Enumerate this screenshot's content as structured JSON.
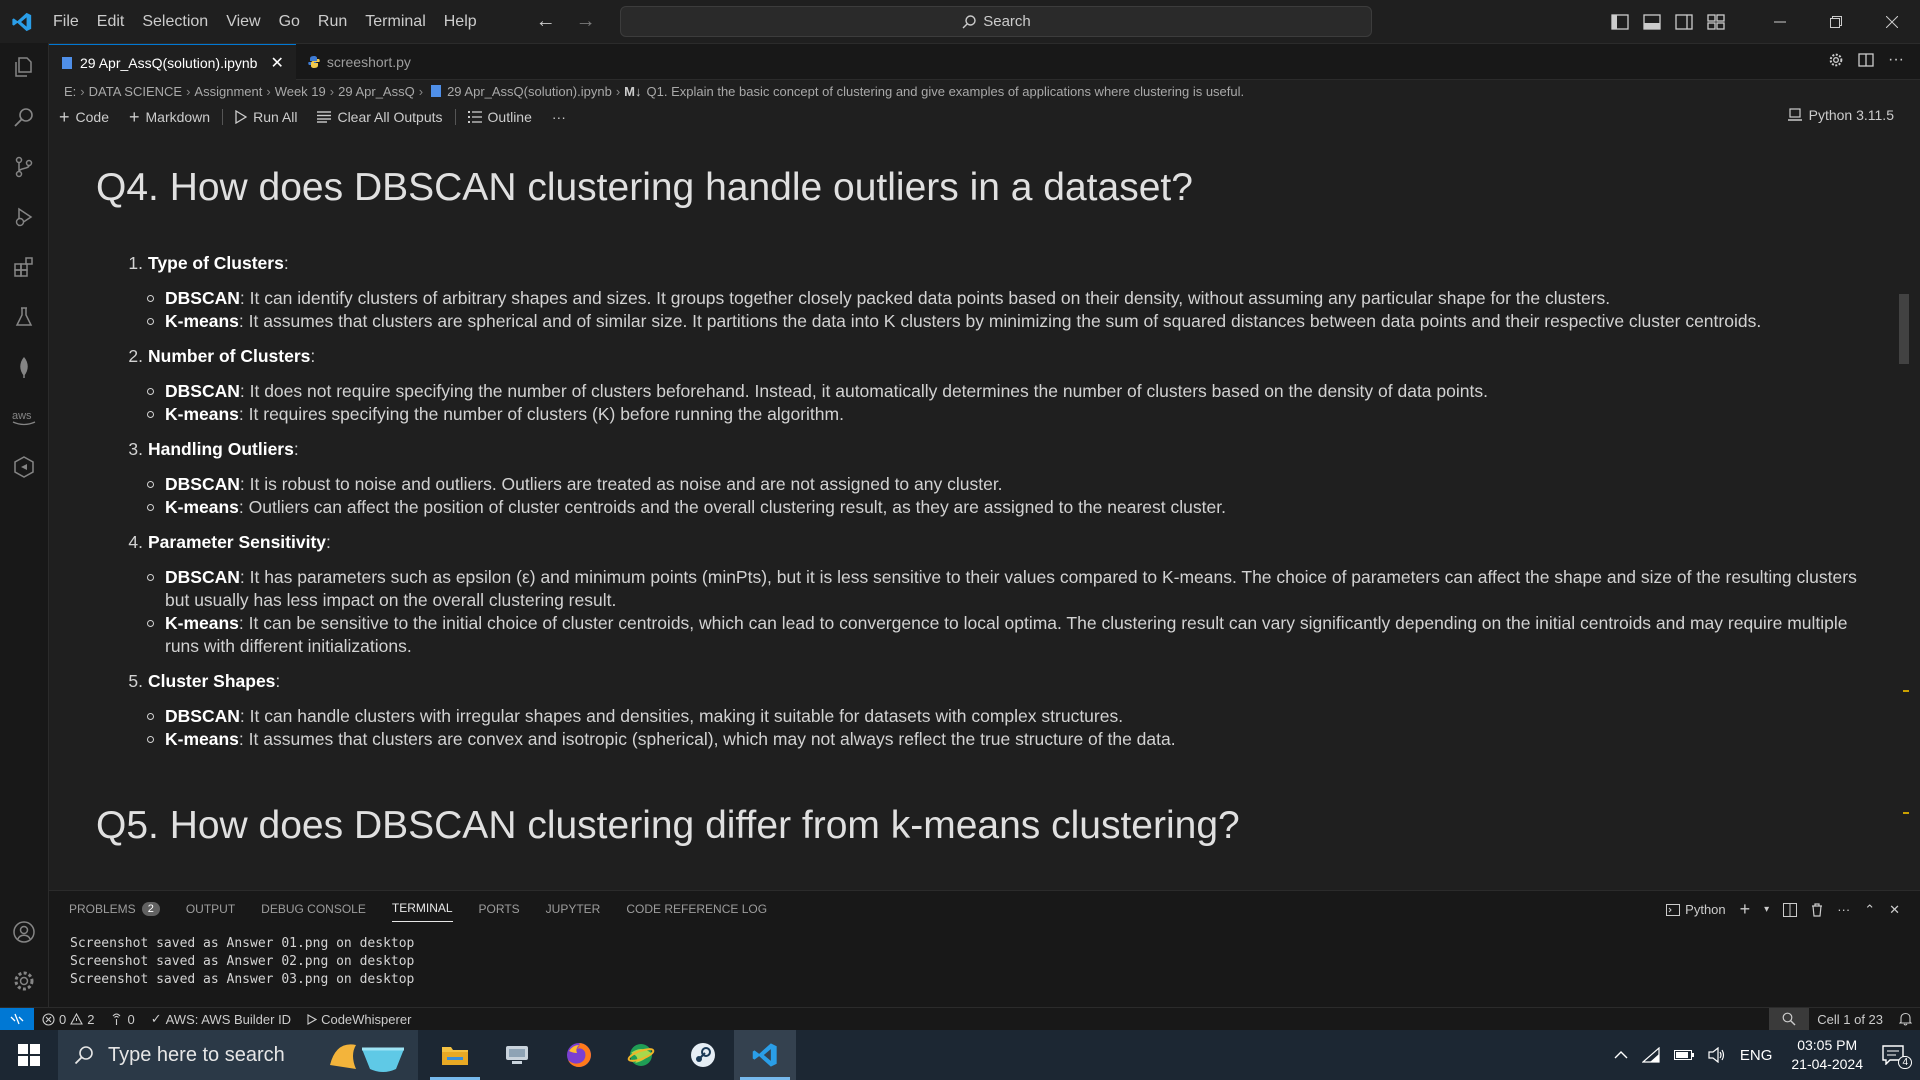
{
  "menu": [
    "File",
    "Edit",
    "Selection",
    "View",
    "Go",
    "Run",
    "Terminal",
    "Help"
  ],
  "search": {
    "label": "Search"
  },
  "tabs": [
    {
      "label": "29 Apr_AssQ(solution).ipynb",
      "active": true
    },
    {
      "label": "screeshort.py",
      "active": false
    }
  ],
  "breadcrumb": [
    "E:",
    "DATA SCIENCE",
    "Assignment",
    "Week 19",
    "29 Apr_AssQ",
    "29 Apr_AssQ(solution).ipynb",
    "Q1. Explain the basic concept of clustering and give examples of applications where clustering is useful."
  ],
  "breadcrumb_md_marker": "M↓",
  "toolbar": {
    "code": "Code",
    "markdown": "Markdown",
    "run_all": "Run All",
    "clear_outputs": "Clear All Outputs",
    "outline": "Outline",
    "more": "···",
    "kernel": "Python 3.11.5"
  },
  "notebook": {
    "q4_heading": "Q4. How does DBSCAN clustering handle outliers in a dataset?",
    "items": [
      {
        "num": "1.",
        "title": "Type of Clusters",
        "dbscan": "It can identify clusters of arbitrary shapes and sizes. It groups together closely packed data points based on their density, without assuming any particular shape for the clusters.",
        "kmeans": "It assumes that clusters are spherical and of similar size. It partitions the data into K clusters by minimizing the sum of squared distances between data points and their respective cluster centroids."
      },
      {
        "num": "2.",
        "title": "Number of Clusters",
        "dbscan": "It does not require specifying the number of clusters beforehand. Instead, it automatically determines the number of clusters based on the density of data points.",
        "kmeans": "It requires specifying the number of clusters (K) before running the algorithm."
      },
      {
        "num": "3.",
        "title": "Handling Outliers",
        "dbscan": "It is robust to noise and outliers. Outliers are treated as noise and are not assigned to any cluster.",
        "kmeans": "Outliers can affect the position of cluster centroids and the overall clustering result, as they are assigned to the nearest cluster."
      },
      {
        "num": "4.",
        "title": "Parameter Sensitivity",
        "dbscan": "It has parameters such as epsilon (ε) and minimum points (minPts), but it is less sensitive to their values compared to K-means. The choice of parameters can affect the shape and size of the resulting clusters but usually has less impact on the overall clustering result.",
        "kmeans": "It can be sensitive to the initial choice of cluster centroids, which can lead to convergence to local optima. The clustering result can vary significantly depending on the initial centroids and may require multiple runs with different initializations."
      },
      {
        "num": "5.",
        "title": "Cluster Shapes",
        "dbscan": "It can handle clusters with irregular shapes and densities, making it suitable for datasets with complex structures.",
        "kmeans": "It assumes that clusters are convex and isotropic (spherical), which may not always reflect the true structure of the data."
      }
    ],
    "label_dbscan": "DBSCAN",
    "label_kmeans": "K-means",
    "q5_heading": "Q5. How does DBSCAN clustering differ from k-means clustering?"
  },
  "panel": {
    "tabs": [
      "PROBLEMS",
      "OUTPUT",
      "DEBUG CONSOLE",
      "TERMINAL",
      "PORTS",
      "JUPYTER",
      "CODE REFERENCE LOG"
    ],
    "problems_count": "2",
    "active_tab": "TERMINAL",
    "shell": "Python",
    "terminal_lines": [
      "Screenshot saved as Answer 01.png on desktop",
      "Screenshot saved as Answer 02.png on desktop",
      "Screenshot saved as Answer 03.png on desktop"
    ]
  },
  "status": {
    "errors": "0",
    "warnings": "2",
    "ports": "0",
    "aws": "AWS: AWS Builder ID",
    "codewhisperer": "CodeWhisperer",
    "cell": "Cell 1 of 23"
  },
  "taskbar": {
    "search_placeholder": "Type here to search",
    "lang": "ENG",
    "time": "03:05 PM",
    "date": "21-04-2024",
    "notifications": "4"
  },
  "colors": {
    "accent": "#0078d4",
    "background": "#1f1f1f",
    "taskbar": "#1c2733"
  }
}
